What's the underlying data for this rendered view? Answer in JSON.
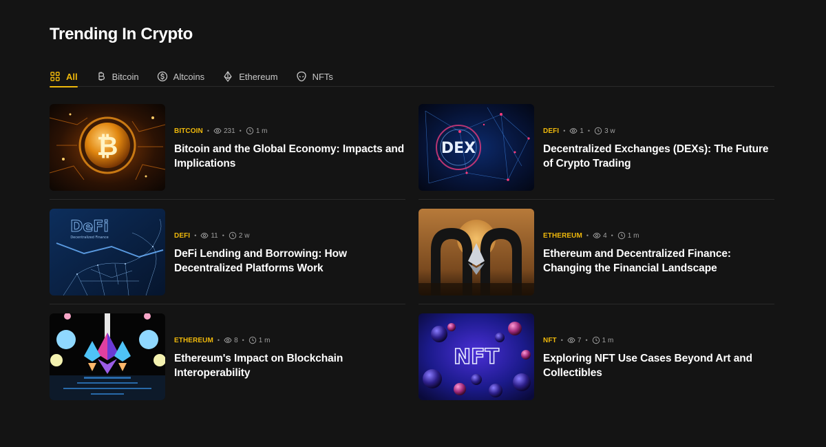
{
  "colors": {
    "background": "#141414",
    "accent": "#f0b90b",
    "divider": "#2a2a2a"
  },
  "page": {
    "title": "Trending In Crypto"
  },
  "tabs": [
    {
      "label": "All",
      "icon": "grid-icon",
      "active": true
    },
    {
      "label": "Bitcoin",
      "icon": "bitcoin-icon",
      "active": false
    },
    {
      "label": "Altcoins",
      "icon": "coin-icon",
      "active": false
    },
    {
      "label": "Ethereum",
      "icon": "ethereum-icon",
      "active": false
    },
    {
      "label": "NFTs",
      "icon": "alien-icon",
      "active": false
    }
  ],
  "articles": [
    {
      "category": "BITCOIN",
      "views": "231",
      "time": "1 m",
      "title": "Bitcoin and the Global Economy: Impacts and Implications",
      "image": "bitcoin-image"
    },
    {
      "category": "DEFI",
      "views": "1",
      "time": "3 w",
      "title": "Decentralized Exchanges (DEXs): The Future of Crypto Trading",
      "image": "dex-image",
      "image_text": "DEX"
    },
    {
      "category": "DEFI",
      "views": "11",
      "time": "2 w",
      "title": "DeFi Lending and Borrowing: How Decentralized Platforms Work",
      "image": "defi-bull-image",
      "image_text": "DeFi",
      "image_subtext": "Decentralized Finance"
    },
    {
      "category": "ETHEREUM",
      "views": "4",
      "time": "1 m",
      "title": "Ethereum and Decentralized Finance: Changing the Financial Landscape",
      "image": "ethereum-arches-image"
    },
    {
      "category": "ETHEREUM",
      "views": "8",
      "time": "1 m",
      "title": "Ethereum's Impact on Blockchain Interoperability",
      "image": "ethereum-crystals-image"
    },
    {
      "category": "NFT",
      "views": "7",
      "time": "1 m",
      "title": "Exploring NFT Use Cases Beyond Art and Collectibles",
      "image": "nft-spheres-image",
      "image_text": "NFT"
    }
  ]
}
